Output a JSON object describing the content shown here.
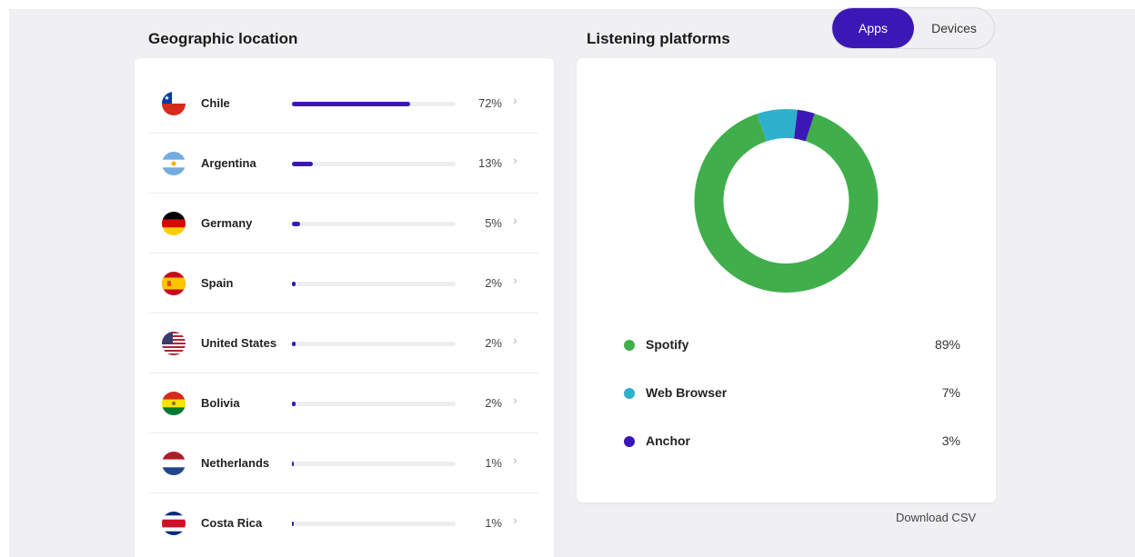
{
  "geo": {
    "title": "Geographic location",
    "rows": [
      {
        "country": "Chile",
        "percent": "72%",
        "value": 72
      },
      {
        "country": "Argentina",
        "percent": "13%",
        "value": 13
      },
      {
        "country": "Germany",
        "percent": "5%",
        "value": 5
      },
      {
        "country": "Spain",
        "percent": "2%",
        "value": 2
      },
      {
        "country": "United States",
        "percent": "2%",
        "value": 2
      },
      {
        "country": "Bolivia",
        "percent": "2%",
        "value": 2
      },
      {
        "country": "Netherlands",
        "percent": "1%",
        "value": 1
      },
      {
        "country": "Costa Rica",
        "percent": "1%",
        "value": 1
      }
    ],
    "bar_color": "#3b18b5"
  },
  "platforms": {
    "title": "Listening platforms",
    "toggle": {
      "apps_label": "Apps",
      "devices_label": "Devices",
      "selected": "Apps"
    },
    "items": [
      {
        "name": "Spotify",
        "percent": "89%",
        "value": 89,
        "color": "#41ae4c"
      },
      {
        "name": "Web Browser",
        "percent": "7%",
        "value": 7,
        "color": "#2fb0cd"
      },
      {
        "name": "Anchor",
        "percent": "3%",
        "value": 3,
        "color": "#3b18b5"
      }
    ],
    "download_label": "Download CSV"
  },
  "icons": {
    "row_chevron": "chevron-right-icon"
  },
  "chevron_glyph": "›"
}
